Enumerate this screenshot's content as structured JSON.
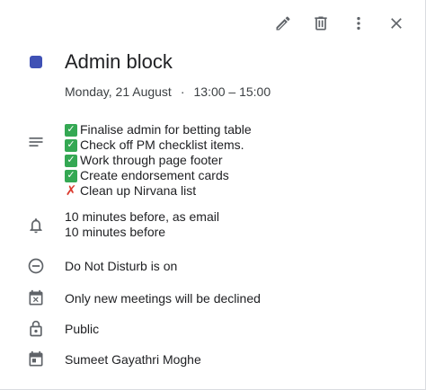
{
  "event": {
    "title": "Admin block",
    "date": "Monday, 21 August",
    "separator": "·",
    "time": "13:00 – 15:00",
    "color": "#3f51b5"
  },
  "toolbar": {
    "edit_icon": "pencil-icon",
    "delete_icon": "trash-icon",
    "more_icon": "more-vert-icon",
    "close_icon": "close-icon"
  },
  "description": {
    "items": [
      {
        "status": "done",
        "text": "Finalise admin for betting table"
      },
      {
        "status": "done",
        "text": "Check off PM checklist items."
      },
      {
        "status": "done",
        "text": "Work through page footer"
      },
      {
        "status": "done",
        "text": "Create endorsement cards"
      },
      {
        "status": "not-done",
        "text": "Clean up Nirvana list"
      }
    ]
  },
  "notifications": {
    "lines": [
      "10 minutes before, as email",
      "10 minutes before"
    ]
  },
  "status": {
    "text": "Do Not Disturb is on"
  },
  "decline": {
    "text": "Only new meetings will be declined"
  },
  "visibility": {
    "text": "Public"
  },
  "calendar": {
    "owner": "Sumeet Gayathri Moghe"
  }
}
